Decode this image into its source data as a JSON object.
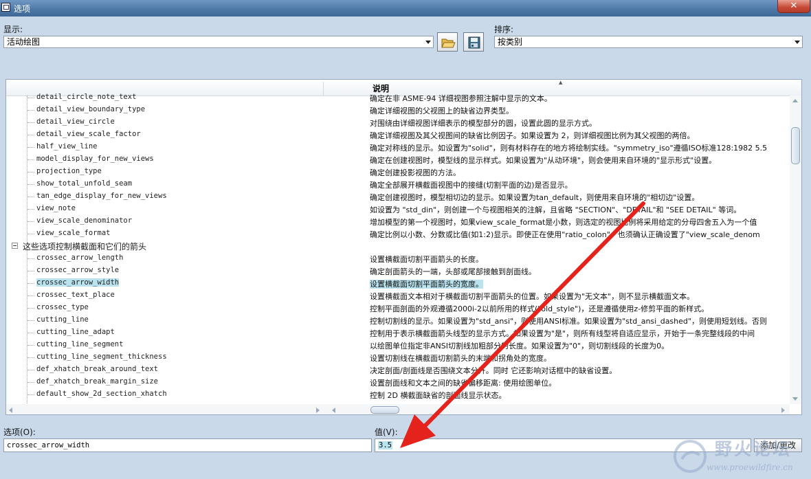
{
  "window": {
    "title": "选项",
    "close_symbol": "✕"
  },
  "display": {
    "label": "显示:",
    "selected": "活动绘图"
  },
  "sort": {
    "label": "排序:",
    "selected": "按类别"
  },
  "table": {
    "header_description": "说明",
    "rows": [
      {
        "type": "item",
        "name": "detail_circle_note_text",
        "desc": "确定在非 ASME-94 详细视图参照注解中显示的文本。"
      },
      {
        "type": "item",
        "name": "detail_view_boundary_type",
        "desc": "确定详细视图的父视图上的缺省边界类型。"
      },
      {
        "type": "item",
        "name": "detail_view_circle",
        "desc": "对围绕由详细视图详细表示的模型部分的圆，设置此圆的显示方式。"
      },
      {
        "type": "item",
        "name": "detail_view_scale_factor",
        "desc": "确定详细视图及其父视图间的缺省比例因子。如果设置为 2，则详细视图比例为其父视图的两倍。"
      },
      {
        "type": "item",
        "name": "half_view_line",
        "desc": "确定对称线的显示。如设置为\"solid\"，则有材料存在的地方将绘制实线。\"symmetry_iso\"遵循ISO标准128:1982 5.5"
      },
      {
        "type": "item",
        "name": "model_display_for_new_views",
        "desc": "确定在创建视图时，模型线的显示样式。如果设置为\"从动环境\"，则会使用来自环境的\"显示形式\"设置。"
      },
      {
        "type": "item",
        "name": "projection_type",
        "desc": "确定创建投影视图的方法。"
      },
      {
        "type": "item",
        "name": "show_total_unfold_seam",
        "desc": "确定全部展开横截面视图中的接缝(切割平面的边)是否显示。"
      },
      {
        "type": "item",
        "name": "tan_edge_display_for_new_views",
        "desc": "确定创建视图时，模型相切边的显示。如果设置为tan_default，则使用来自环境的\"相切边\"设置。"
      },
      {
        "type": "item",
        "name": "view_note",
        "desc": "如设置为 \"std_din\"，则创建一个与视图相关的注解，且省略 \"SECTION\"、\"DETAIL\"和 \"SEE DETAIL\" 等词。"
      },
      {
        "type": "item",
        "name": "view_scale_denominator",
        "desc": "增加模型的第一个视图时，如果view_scale_format是小数，则选定的视图比例将采用给定的分母四舍五入为一个值"
      },
      {
        "type": "item",
        "name": "view_scale_format",
        "desc": "确定比例以小数、分数或比值(如1:2)显示。即使正在使用\"ratio_colon\"，也须确认正确设置了\"view_scale_denom"
      },
      {
        "type": "group",
        "name": "这些选项控制横截面和它们的箭头",
        "desc": ""
      },
      {
        "type": "item",
        "name": "crossec_arrow_length",
        "desc": "设置横截面切割平面箭头的长度。"
      },
      {
        "type": "item",
        "name": "crossec_arrow_style",
        "desc": "确定剖面箭头的一端，头部或尾部接触到剖面线。"
      },
      {
        "type": "item",
        "name": "crossec_arrow_width",
        "desc": "设置横截面切割平面箭头的宽度。",
        "selected": true
      },
      {
        "type": "item",
        "name": "crossec_text_place",
        "desc": "设置横截面文本相对于横截面切割平面箭头的位置。如果设置为\"无文本\"，则不显示横截面文本。"
      },
      {
        "type": "item",
        "name": "crossec_type",
        "desc": "控制平面剖面的外观遵循2000i-2以前所用的样式(\"old_style\")，还是遵循使用z-修剪平面的新样式。"
      },
      {
        "type": "item",
        "name": "cutting_line",
        "desc": "控制切割线的显示。如果设置为\"std_ansi\"，则使用ANSI标准。如果设置为\"std_ansi_dashed\"，则使用短划线。否则"
      },
      {
        "type": "item",
        "name": "cutting_line_adapt",
        "desc": "控制用于表示横截面箭头线型的显示方式。如果设置为\"是\"，则所有线型将自适应显示，开始于一条完整线段的中间"
      },
      {
        "type": "item",
        "name": "cutting_line_segment",
        "desc": "以绘图单位指定非ANSI切割线加粗部分的长度。如果设置为\"0\"，则切割线段的长度为0。"
      },
      {
        "type": "item",
        "name": "cutting_line_segment_thickness",
        "desc": "设置切割线在横截面切割箭头的末端和拐角处的宽度。"
      },
      {
        "type": "item",
        "name": "def_xhatch_break_around_text",
        "desc": "决定剖面/剖面线是否围绕文本分开。同时 它还影响对话框中的缺省设置。"
      },
      {
        "type": "item",
        "name": "def_xhatch_break_margin_size",
        "desc": "设置剖面线和文本之间的缺省偏移距离: 使用绘图单位。"
      },
      {
        "type": "item",
        "name": "default_show_2d_section_xhatch",
        "desc": "控制 2D 横截面缺省的剖面线显示状态。"
      }
    ]
  },
  "option_field": {
    "label": "选项(O):",
    "value": "crossec_arrow_width"
  },
  "value_field": {
    "label": "值(V):",
    "value": "3.5"
  },
  "buttons": {
    "add_change": "添加/更改"
  },
  "watermark": {
    "text": "野火论坛",
    "url": "www.proewildfire.cn"
  },
  "colors": {
    "titlebar": "#4f7aa8",
    "selection": "#b9e4ef",
    "annotation_arrow": "#e3231c",
    "background": "#c9d9ea"
  }
}
